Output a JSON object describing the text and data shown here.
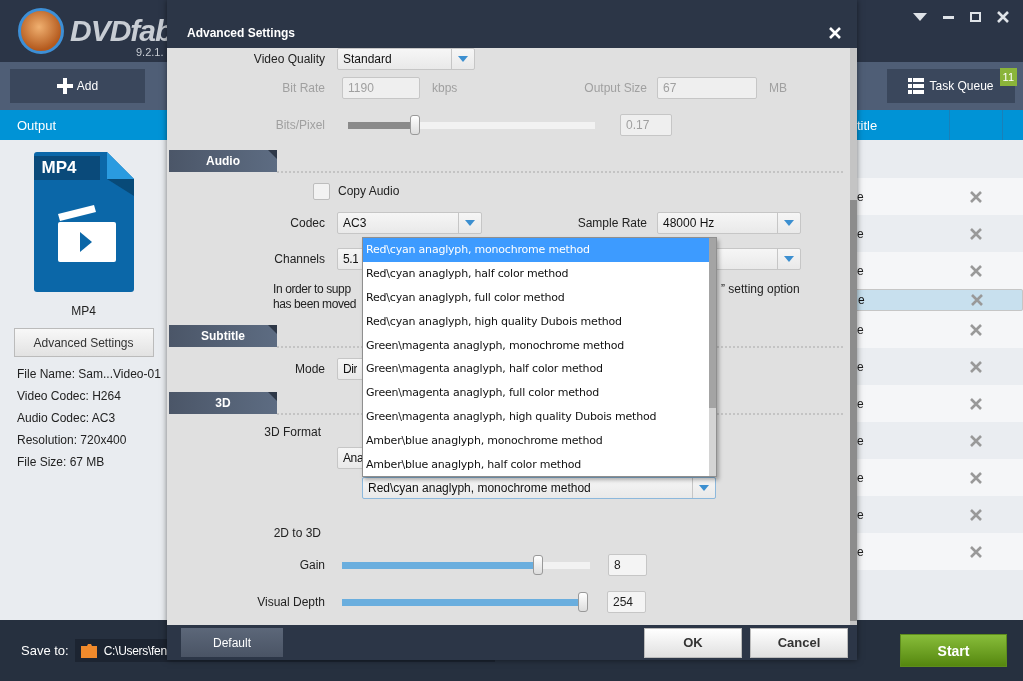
{
  "app": {
    "logo": "DVDfab",
    "version": "9.2.1.",
    "add": "Add",
    "task_queue": "Task Queue",
    "queue_count": "11",
    "output_header": "Output",
    "title_header": "title",
    "profile": {
      "badge": "MP4",
      "name": "MP4",
      "button": "Advanced Settings",
      "info": [
        "File Name: Sam...Video-01",
        "Video Codec: H264",
        "Audio Codec: AC3",
        "Resolution: 720x400",
        "File Size: 67 MB"
      ]
    },
    "rows": [
      {
        "column_1": "e",
        "selected": false
      },
      {
        "column_1": "e",
        "selected": false
      },
      {
        "column_1": "e",
        "selected": false
      },
      {
        "column_1": "e",
        "selected": true
      },
      {
        "column_1": "e",
        "selected": false
      },
      {
        "column_1": "e",
        "selected": false
      },
      {
        "column_1": "e",
        "selected": false
      },
      {
        "column_1": "e",
        "selected": false
      },
      {
        "column_1": "e",
        "selected": false
      },
      {
        "column_1": "e",
        "selected": false
      },
      {
        "column_1": "e",
        "selected": false
      }
    ],
    "save_to": {
      "label": "Save to:",
      "path": "C:\\Users\\fen"
    },
    "start": "Start"
  },
  "dialog": {
    "title": "Advanced Settings",
    "video_quality": {
      "label": "Video Quality",
      "value": "Standard"
    },
    "bit_rate": {
      "label": "Bit Rate",
      "value": "1190",
      "unit": "kbps",
      "disabled": true
    },
    "output_size": {
      "label": "Output Size",
      "value": "67",
      "unit": "MB",
      "disabled": true
    },
    "bits_per_pixel": {
      "label": "Bits/Pixel",
      "level": 0.27,
      "value": "0.17",
      "disabled": true
    },
    "audio": {
      "section": "Audio",
      "copy_audio": {
        "label": "Copy Audio",
        "checked": false
      },
      "codec": {
        "label": "Codec",
        "value": "AC3"
      },
      "sample_rate": {
        "label": "Sample Rate",
        "value": "48000 Hz"
      },
      "channels": {
        "label": "Channels",
        "value": "5.1"
      },
      "note_left": [
        "In order to supp",
        "has been moved"
      ],
      "note_right": "” setting option"
    },
    "subtitle": {
      "section": "Subtitle",
      "mode": {
        "label": "Mode",
        "value": "Dir"
      }
    },
    "three_d": {
      "section": "3D",
      "format_label": "3D Format",
      "format_value": "Ana",
      "method": "Red\\cyan anaglyph, monochrome method",
      "two_d_to_three_d": "2D to 3D",
      "gain": {
        "label": "Gain",
        "level": 0.79,
        "value": "8"
      },
      "visual_depth": {
        "label": "Visual Depth",
        "level": 0.98,
        "value": "254"
      }
    },
    "method_list": [
      {
        "label": "Red\\cyan anaglyph, monochrome method",
        "selected": true
      },
      {
        "label": "Red\\cyan anaglyph, half color method",
        "selected": false
      },
      {
        "label": "Red\\cyan anaglyph, full color method",
        "selected": false
      },
      {
        "label": "Red\\cyan anaglyph, high quality Dubois method",
        "selected": false
      },
      {
        "label": "Green\\magenta anaglyph, monochrome method",
        "selected": false
      },
      {
        "label": "Green\\magenta anaglyph, half color method",
        "selected": false
      },
      {
        "label": "Green\\magenta anaglyph, full color method",
        "selected": false
      },
      {
        "label": "Green\\magenta anaglyph, high quality Dubois method",
        "selected": false
      },
      {
        "label": "Amber\\blue anaglyph, monochrome method",
        "selected": false
      },
      {
        "label": "Amber\\blue anaglyph, half color method",
        "selected": false
      }
    ],
    "buttons": {
      "default": "Default",
      "ok": "OK",
      "cancel": "Cancel"
    }
  }
}
